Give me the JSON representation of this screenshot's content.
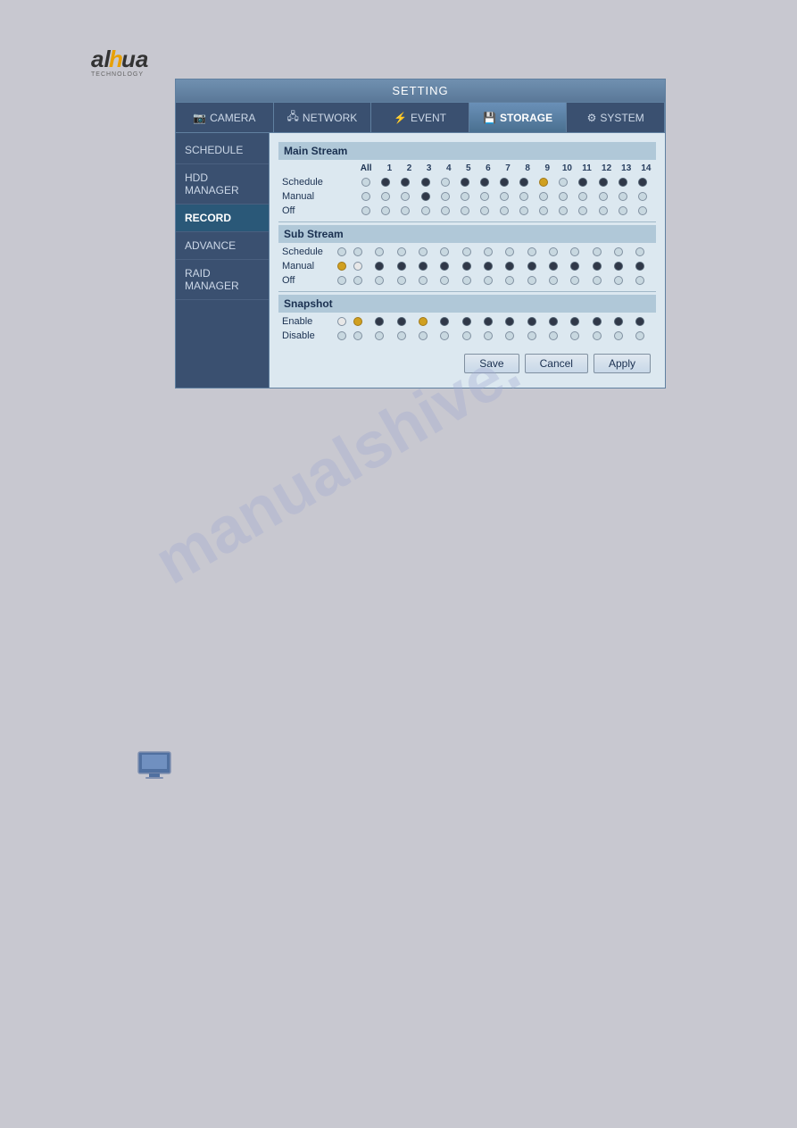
{
  "logo": {
    "brand": "alhua",
    "tagline": "TECHNOLOGY"
  },
  "header": {
    "title": "SETTING"
  },
  "nav_tabs": [
    {
      "id": "camera",
      "label": "CAMERA",
      "active": false
    },
    {
      "id": "network",
      "label": "NETWORK",
      "active": false
    },
    {
      "id": "event",
      "label": "EVENT",
      "active": false
    },
    {
      "id": "storage",
      "label": "STORAGE",
      "active": true
    },
    {
      "id": "system",
      "label": "SYSTEM",
      "active": false
    }
  ],
  "sidebar": {
    "items": [
      {
        "id": "schedule",
        "label": "SCHEDULE",
        "active": false
      },
      {
        "id": "hdd_manager",
        "label": "HDD MANAGER",
        "active": false
      },
      {
        "id": "record",
        "label": "RECORD",
        "active": true
      },
      {
        "id": "advance",
        "label": "ADVANCE",
        "active": false
      },
      {
        "id": "raid_manager",
        "label": "RAID MANAGER",
        "active": false
      }
    ]
  },
  "record": {
    "main_stream": {
      "label": "Main Stream",
      "all_label": "All",
      "numbers": [
        "1",
        "2",
        "3",
        "4",
        "5",
        "6",
        "7",
        "8",
        "9",
        "10",
        "11",
        "12",
        "13",
        "14"
      ],
      "rows": [
        {
          "label": "Schedule",
          "type": "radio",
          "all_state": "empty",
          "states": [
            "dark",
            "dark",
            "dark",
            "empty",
            "dark",
            "dark",
            "dark",
            "dark",
            "yellow",
            "empty",
            "dark",
            "dark",
            "dark",
            "dark"
          ]
        },
        {
          "label": "Manual",
          "type": "radio",
          "all_state": "empty",
          "states": [
            "empty",
            "empty",
            "dark",
            "empty",
            "empty",
            "empty",
            "empty",
            "empty",
            "empty",
            "empty",
            "empty",
            "empty",
            "empty",
            "empty"
          ]
        },
        {
          "label": "Off",
          "type": "radio",
          "all_state": "empty",
          "states": [
            "empty",
            "empty",
            "empty",
            "empty",
            "empty",
            "empty",
            "empty",
            "empty",
            "empty",
            "empty",
            "empty",
            "empty",
            "empty",
            "empty"
          ]
        }
      ]
    },
    "sub_stream": {
      "label": "Sub Stream",
      "rows": [
        {
          "label": "Schedule",
          "type": "radio",
          "all_state": "empty",
          "states": [
            "empty",
            "empty",
            "empty",
            "empty",
            "empty",
            "empty",
            "empty",
            "empty",
            "empty",
            "empty",
            "empty",
            "empty",
            "empty",
            "empty"
          ]
        },
        {
          "label": "Manual",
          "type": "radio",
          "all_state": "yellow",
          "states": [
            "white",
            "dark",
            "dark",
            "dark",
            "dark",
            "dark",
            "dark",
            "dark",
            "dark",
            "dark",
            "dark",
            "dark",
            "dark",
            "dark"
          ]
        },
        {
          "label": "Off",
          "type": "radio",
          "all_state": "empty",
          "states": [
            "empty",
            "empty",
            "empty",
            "empty",
            "empty",
            "empty",
            "empty",
            "empty",
            "empty",
            "empty",
            "empty",
            "empty",
            "empty",
            "empty"
          ]
        }
      ]
    },
    "snapshot": {
      "label": "Snapshot",
      "rows": [
        {
          "label": "Enable",
          "type": "radio",
          "all_state": "white",
          "states": [
            "yellow",
            "dark",
            "dark",
            "yellow",
            "dark",
            "dark",
            "dark",
            "dark",
            "dark",
            "dark",
            "dark",
            "dark",
            "dark",
            "dark"
          ]
        },
        {
          "label": "Disable",
          "type": "radio",
          "all_state": "empty",
          "states": [
            "empty",
            "empty",
            "empty",
            "empty",
            "empty",
            "empty",
            "empty",
            "empty",
            "empty",
            "empty",
            "empty",
            "empty",
            "empty",
            "empty"
          ]
        }
      ]
    }
  },
  "buttons": {
    "save": "Save",
    "cancel": "Cancel",
    "apply": "Apply"
  },
  "watermark": "manualshive."
}
